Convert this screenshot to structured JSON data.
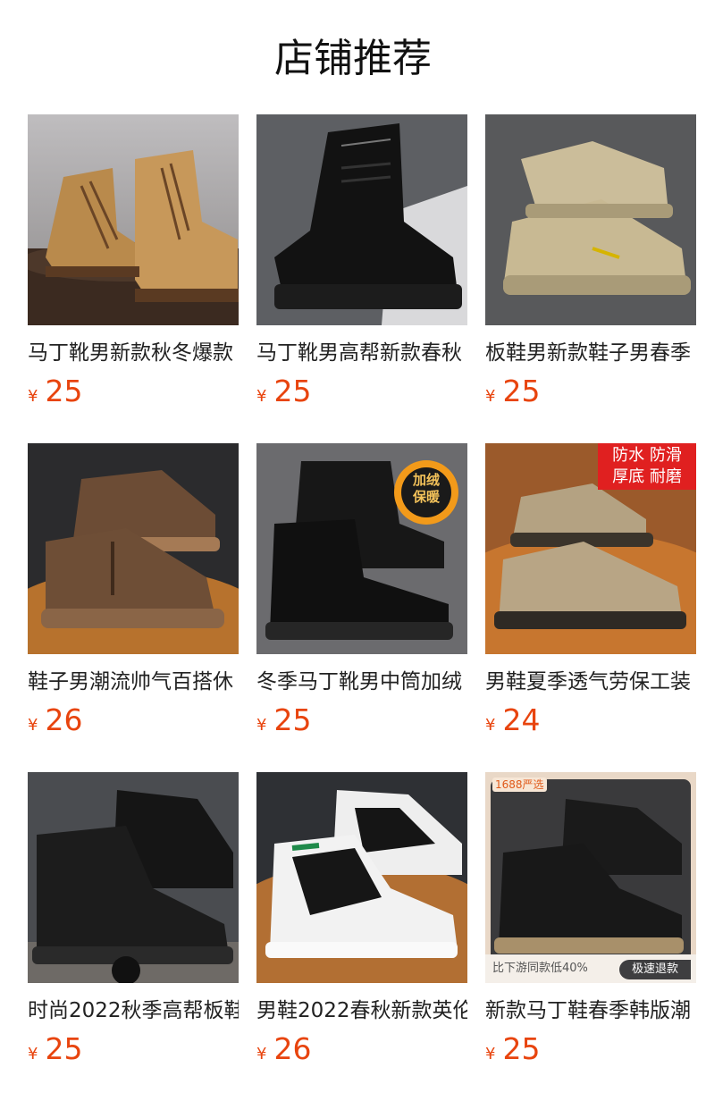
{
  "section": {
    "title": "店铺推荐"
  },
  "currency_symbol": "¥",
  "products": [
    {
      "name": "马丁靴男新款秋冬爆款",
      "price": "25"
    },
    {
      "name": "马丁靴男高帮新款春秋",
      "price": "25"
    },
    {
      "name": "板鞋男新款鞋子男春季",
      "price": "25"
    },
    {
      "name": "鞋子男潮流帅气百搭休",
      "price": "26"
    },
    {
      "name": "冬季马丁靴男中筒加绒",
      "price": "25",
      "badge": "加绒保暖"
    },
    {
      "name": "男鞋夏季透气劳保工装",
      "price": "24",
      "badge_lines": [
        "防水 防滑",
        "厚底 耐磨"
      ]
    },
    {
      "name": "时尚2022秋季高帮板鞋",
      "price": "25"
    },
    {
      "name": "男鞋2022春秋新款英伦",
      "price": "26"
    },
    {
      "name": "新款马丁鞋春季韩版潮",
      "price": "25",
      "corner_label": "1688严选",
      "promo_left": "比下游同款低40%",
      "promo_right": "极速退款"
    }
  ],
  "colors": {
    "price": "#e8440e",
    "badge_red": "#e02020"
  }
}
